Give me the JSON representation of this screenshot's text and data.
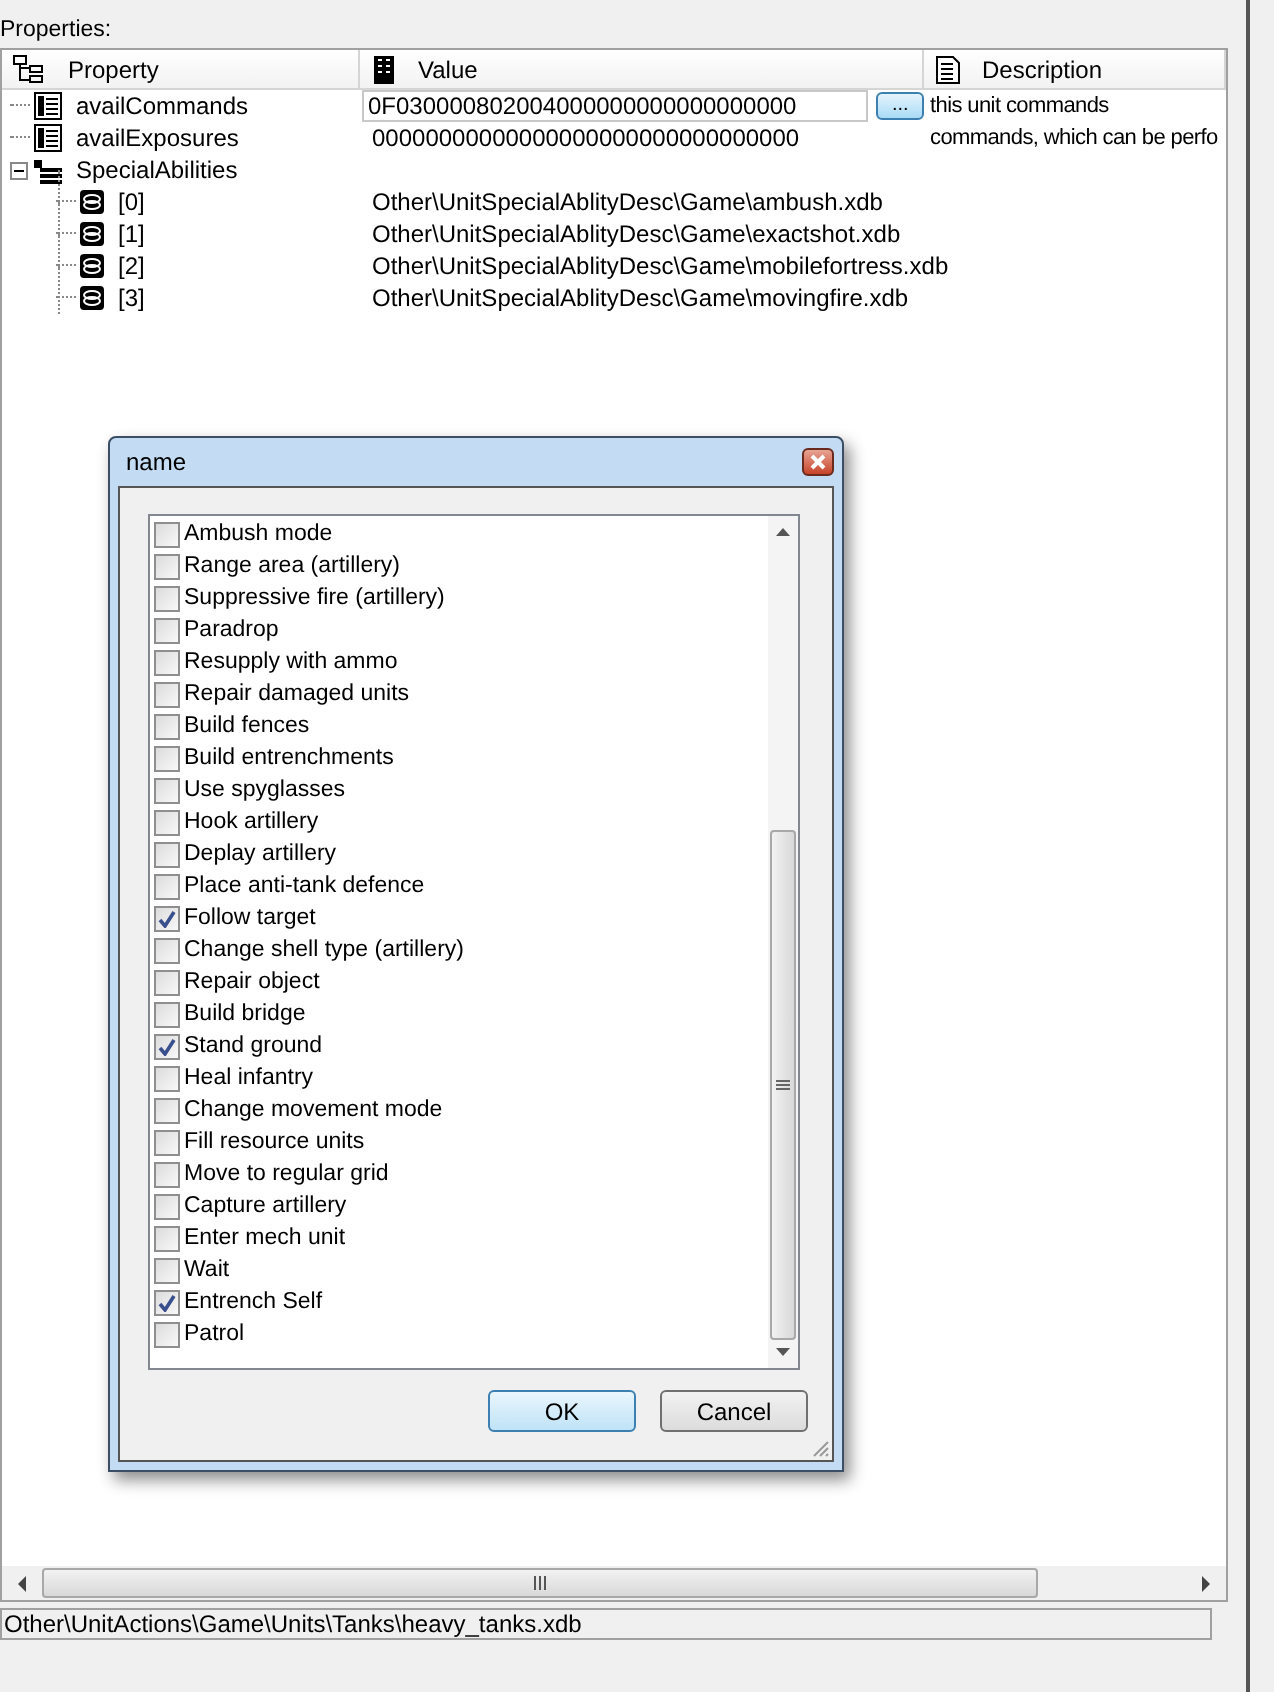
{
  "properties_label": "Properties:",
  "grid": {
    "columns": [
      {
        "label": "Property",
        "kind": "tree"
      },
      {
        "label": "Value",
        "kind": "table"
      },
      {
        "label": "Description",
        "kind": "doc"
      }
    ],
    "rows": [
      {
        "property": "availCommands",
        "kind": "list",
        "value": "0F030000802004000000000000000000",
        "description": "this unit commands",
        "editing": true,
        "ellipsis": "..."
      },
      {
        "property": "availExposures",
        "kind": "list",
        "value": "00000000000000000000000000000000",
        "description": "commands, which can be perfo",
        "editing": false
      },
      {
        "property": "SpecialAbilities",
        "kind": "folder",
        "expanded": true,
        "children": [
          {
            "property": "[0]",
            "kind": "link",
            "value": "Other\\UnitSpecialAblityDesc\\Game\\ambush.xdb"
          },
          {
            "property": "[1]",
            "kind": "link",
            "value": "Other\\UnitSpecialAblityDesc\\Game\\exactshot.xdb"
          },
          {
            "property": "[2]",
            "kind": "link",
            "value": "Other\\UnitSpecialAblityDesc\\Game\\mobilefortress.xdb"
          },
          {
            "property": "[3]",
            "kind": "link",
            "value": "Other\\UnitSpecialAblityDesc\\Game\\movingfire.xdb"
          }
        ]
      }
    ]
  },
  "status_path": "Other\\UnitActions\\Game\\Units\\Tanks\\heavy_tanks.xdb",
  "dialog": {
    "title": "name",
    "items": [
      {
        "label": "Ambush mode",
        "checked": false
      },
      {
        "label": "Range area (artillery)",
        "checked": false
      },
      {
        "label": "Suppressive fire (artillery)",
        "checked": false
      },
      {
        "label": "Paradrop",
        "checked": false
      },
      {
        "label": "Resupply with ammo",
        "checked": false
      },
      {
        "label": "Repair damaged units",
        "checked": false
      },
      {
        "label": "Build fences",
        "checked": false
      },
      {
        "label": "Build entrenchments",
        "checked": false
      },
      {
        "label": "Use spyglasses",
        "checked": false
      },
      {
        "label": "Hook artillery",
        "checked": false
      },
      {
        "label": "Deplay artillery",
        "checked": false
      },
      {
        "label": "Place anti-tank defence",
        "checked": false
      },
      {
        "label": "Follow target",
        "checked": true
      },
      {
        "label": "Change shell type (artillery)",
        "checked": false
      },
      {
        "label": "Repair object",
        "checked": false
      },
      {
        "label": "Build bridge",
        "checked": false
      },
      {
        "label": "Stand ground",
        "checked": true
      },
      {
        "label": "Heal infantry",
        "checked": false
      },
      {
        "label": "Change movement mode",
        "checked": false
      },
      {
        "label": "Fill resource units",
        "checked": false
      },
      {
        "label": "Move to regular grid",
        "checked": false
      },
      {
        "label": "Capture artillery",
        "checked": false
      },
      {
        "label": "Enter mech unit",
        "checked": false
      },
      {
        "label": "Wait",
        "checked": false
      },
      {
        "label": "Entrench Self",
        "checked": true
      },
      {
        "label": "Patrol",
        "checked": false
      }
    ],
    "buttons": [
      {
        "label": "OK",
        "default": true
      },
      {
        "label": "Cancel",
        "default": false
      }
    ]
  }
}
